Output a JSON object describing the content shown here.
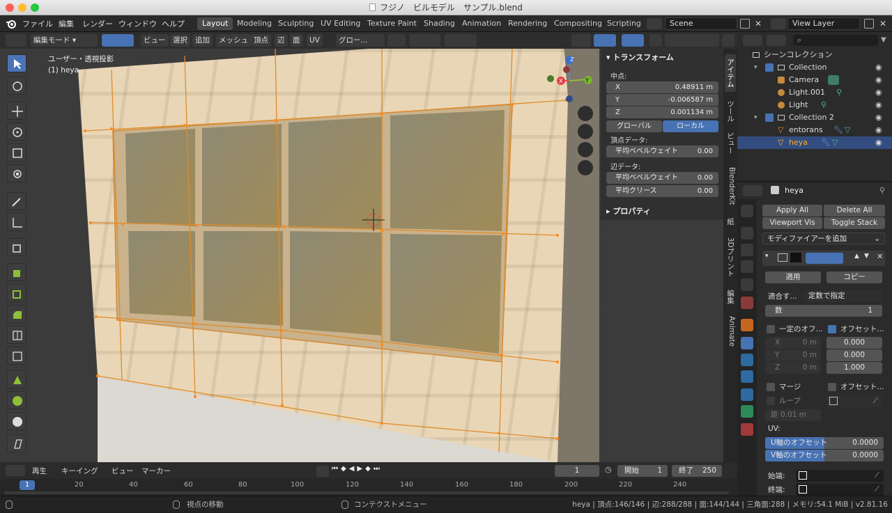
{
  "window": {
    "title": "フジノ　ビルモデル　サンプル.blend"
  },
  "topbar": {
    "menus": [
      "ファイル",
      "編集",
      "レンダー",
      "ウィンドウ",
      "ヘルプ"
    ],
    "workspaces": [
      "Layout",
      "Modeling",
      "Sculpting",
      "UV Editing",
      "Texture Paint",
      "Shading",
      "Animation",
      "Rendering",
      "Compositing",
      "Scripting"
    ],
    "active_workspace": "Layout",
    "scene": "Scene",
    "view_layer": "View Layer"
  },
  "header3d": {
    "mode": "編集モード",
    "menus": [
      "ビュー",
      "選択",
      "追加",
      "メッシュ",
      "頂点",
      "辺",
      "面",
      "UV"
    ],
    "orientation": "グロー..."
  },
  "viewport": {
    "view_label": "ユーザー・透視投影",
    "object_label": "(1) heya",
    "gizmo_axes": {
      "x": "X",
      "y": "Y",
      "z": "Z"
    }
  },
  "npanel": {
    "transform_title": "トランスフォーム",
    "median_label": "中点:",
    "coords": [
      {
        "axis": "X",
        "value": "0.48911 m"
      },
      {
        "axis": "Y",
        "value": "-0.006587 m"
      },
      {
        "axis": "Z",
        "value": "0.001134 m"
      }
    ],
    "global_label": "グローバル",
    "local_label": "ローカル",
    "vertex_data_label": "頂点データ:",
    "vertex_bevel_label": "平均ベベルウェイト",
    "vertex_bevel_value": "0.00",
    "edge_data_label": "辺データ:",
    "edge_bevel_label": "平均ベベルウェイト",
    "edge_bevel_value": "0.00",
    "crease_label": "平均クリース",
    "crease_value": "0.00",
    "properties_title": "プロパティ"
  },
  "sidebar_tabs": [
    "アイテム",
    "ツール",
    "ビュー",
    "BlenderKit",
    "紙",
    "3Dプリント",
    "編集",
    "Animate"
  ],
  "outliner": {
    "root": "シーンコレクション",
    "rows": [
      {
        "label": "Collection",
        "indent": 1
      },
      {
        "label": "Camera",
        "indent": 2
      },
      {
        "label": "Light.001",
        "indent": 2
      },
      {
        "label": "Light",
        "indent": 2
      },
      {
        "label": "Collection 2",
        "indent": 1
      },
      {
        "label": "entorans",
        "indent": 2
      },
      {
        "label": "heya",
        "indent": 2
      }
    ]
  },
  "properties": {
    "object_name": "heya",
    "apply_all": "Apply All",
    "delete_all": "Delete All",
    "viewport_vis": "Viewport Vis",
    "toggle_stack": "Toggle Stack",
    "add_modifier": "モディファイアーを追加",
    "apply": "適用",
    "copy": "コピー",
    "fit_label": "適合す...",
    "fit_value": "定数で指定",
    "count_label": "数",
    "count_value": "1",
    "const_offset": "一定のオフ...",
    "rel_offset": "オフセット...",
    "const_axes": [
      {
        "axis": "X",
        "value": "0 m"
      },
      {
        "axis": "Y",
        "value": "0 m"
      },
      {
        "axis": "Z",
        "value": "0 m"
      }
    ],
    "rel_values": [
      "0.000",
      "0.000",
      "1.000"
    ],
    "merge": "マージ",
    "obj_offset": "オフセット...",
    "loop": "ループ",
    "distance_label": "距",
    "distance_value": "0.01 m",
    "uv_label": "UV:",
    "u_offset_label": "U軸のオフセット",
    "u_offset_value": "0.0000",
    "v_offset_label": "V軸のオフセット",
    "v_offset_value": "0.0000",
    "start_cap": "始端:",
    "end_cap": "終端:"
  },
  "timeline": {
    "menus": [
      "再生",
      "キーイング",
      "ビュー",
      "マーカー"
    ],
    "current_frame": "1",
    "start_label": "開始",
    "start_value": "1",
    "end_label": "終了",
    "end_value": "250",
    "ticks": [
      "1",
      "20",
      "40",
      "60",
      "80",
      "100",
      "120",
      "140",
      "160",
      "180",
      "200",
      "220",
      "240"
    ]
  },
  "statusbar": {
    "left": "視点の移動",
    "middle": "コンテクストメニュー",
    "right": "heya | 頂点:146/146 | 辺:288/288 | 面:144/144 | 三角面:288 | メモリ:54.1 MiB | v2.81.16"
  }
}
